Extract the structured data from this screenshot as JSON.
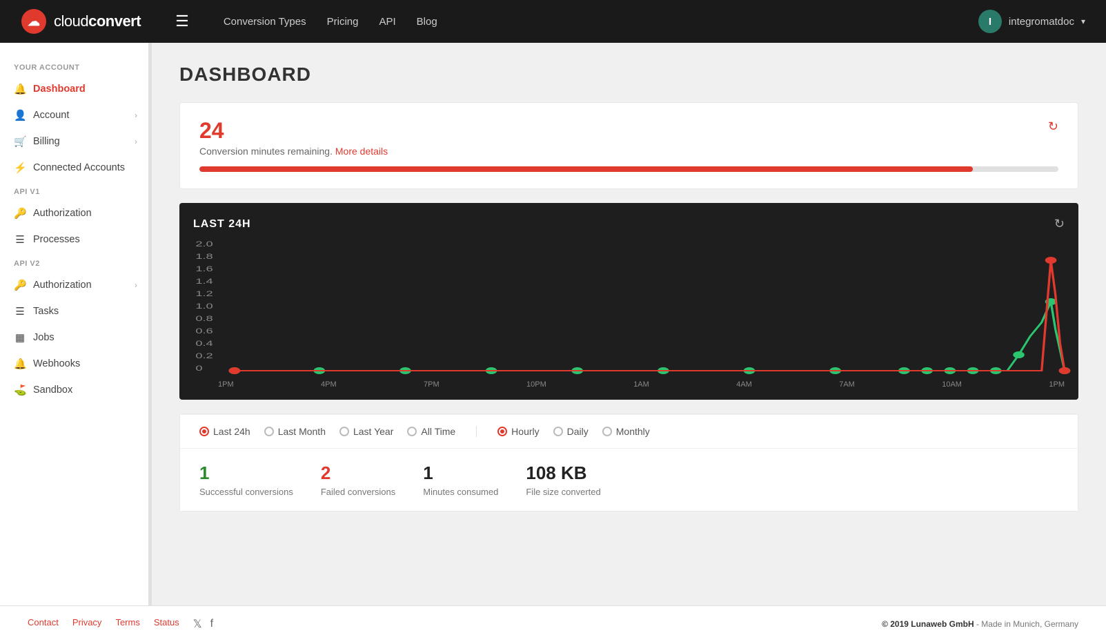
{
  "topnav": {
    "logo_cloud": "cloud",
    "logo_text_plain": "cloud",
    "logo_text_bold": "convert",
    "hamburger": "☰",
    "nav_links": [
      {
        "label": "Conversion Types",
        "key": "conversion-types"
      },
      {
        "label": "Pricing",
        "key": "pricing"
      },
      {
        "label": "API",
        "key": "api"
      },
      {
        "label": "Blog",
        "key": "blog"
      }
    ],
    "user_initial": "I",
    "user_name": "integromatdoc",
    "chevron": "▾"
  },
  "sidebar": {
    "your_account_label": "YOUR ACCOUNT",
    "items_account": [
      {
        "label": "Dashboard",
        "icon": "🔔",
        "active": true,
        "has_chevron": false,
        "key": "dashboard"
      },
      {
        "label": "Account",
        "icon": "👤",
        "active": false,
        "has_chevron": true,
        "key": "account"
      },
      {
        "label": "Billing",
        "icon": "🛒",
        "active": false,
        "has_chevron": true,
        "key": "billing"
      },
      {
        "label": "Connected Accounts",
        "icon": "⚡",
        "active": false,
        "has_chevron": false,
        "key": "connected-accounts"
      }
    ],
    "api_v1_label": "API V1",
    "items_api_v1": [
      {
        "label": "Authorization",
        "icon": "🔑",
        "active": false,
        "has_chevron": false,
        "key": "auth-v1"
      },
      {
        "label": "Processes",
        "icon": "≡",
        "active": false,
        "has_chevron": false,
        "key": "processes"
      }
    ],
    "api_v2_label": "API V2",
    "items_api_v2": [
      {
        "label": "Authorization",
        "icon": "🔑",
        "active": false,
        "has_chevron": true,
        "key": "auth-v2"
      },
      {
        "label": "Tasks",
        "icon": "≡",
        "active": false,
        "has_chevron": false,
        "key": "tasks"
      },
      {
        "label": "Jobs",
        "icon": "▦",
        "active": false,
        "has_chevron": false,
        "key": "jobs"
      },
      {
        "label": "Webhooks",
        "icon": "🔔",
        "active": false,
        "has_chevron": false,
        "key": "webhooks"
      },
      {
        "label": "Sandbox",
        "icon": "⛱",
        "active": false,
        "has_chevron": false,
        "key": "sandbox"
      }
    ]
  },
  "main": {
    "page_title": "DASHBOARD",
    "conversion_card": {
      "minutes_num": "24",
      "minutes_text": "Conversion minutes remaining.",
      "more_details_text": "More details",
      "refresh_symbol": "↻",
      "progress_percent": 90
    },
    "chart": {
      "title": "LAST 24H",
      "refresh_symbol": "↻",
      "y_labels": [
        "2.0",
        "1.8",
        "1.6",
        "1.4",
        "1.2",
        "1.0",
        "0.8",
        "0.6",
        "0.4",
        "0.2",
        "0"
      ],
      "x_labels": [
        "1PM",
        "4PM",
        "7PM",
        "10PM",
        "1AM",
        "4AM",
        "7AM",
        "10AM",
        "1PM"
      ]
    },
    "filters": {
      "time_options": [
        {
          "label": "Last 24h",
          "active": true,
          "key": "last-24h"
        },
        {
          "label": "Last Month",
          "active": false,
          "key": "last-month"
        },
        {
          "label": "Last Year",
          "active": false,
          "key": "last-year"
        },
        {
          "label": "All Time",
          "active": false,
          "key": "all-time"
        }
      ],
      "interval_options": [
        {
          "label": "Hourly",
          "active": true,
          "key": "hourly"
        },
        {
          "label": "Daily",
          "active": false,
          "key": "daily"
        },
        {
          "label": "Monthly",
          "active": false,
          "key": "monthly"
        }
      ]
    },
    "stats": [
      {
        "num": "1",
        "label": "Successful conversions",
        "color": "green"
      },
      {
        "num": "2",
        "label": "Failed conversions",
        "color": "red"
      },
      {
        "num": "1",
        "label": "Minutes consumed",
        "color": "black"
      },
      {
        "num": "108 KB",
        "label": "File size converted",
        "color": "black"
      }
    ]
  },
  "footer": {
    "links": [
      {
        "label": "Contact",
        "key": "contact"
      },
      {
        "label": "Privacy",
        "key": "privacy"
      },
      {
        "label": "Terms",
        "key": "terms"
      },
      {
        "label": "Status",
        "key": "status"
      }
    ],
    "social_twitter": "𝕏",
    "social_facebook": "f",
    "copyright": "© 2019 Lunaweb GmbH",
    "copyright_suffix": " - Made in Munich, Germany"
  }
}
